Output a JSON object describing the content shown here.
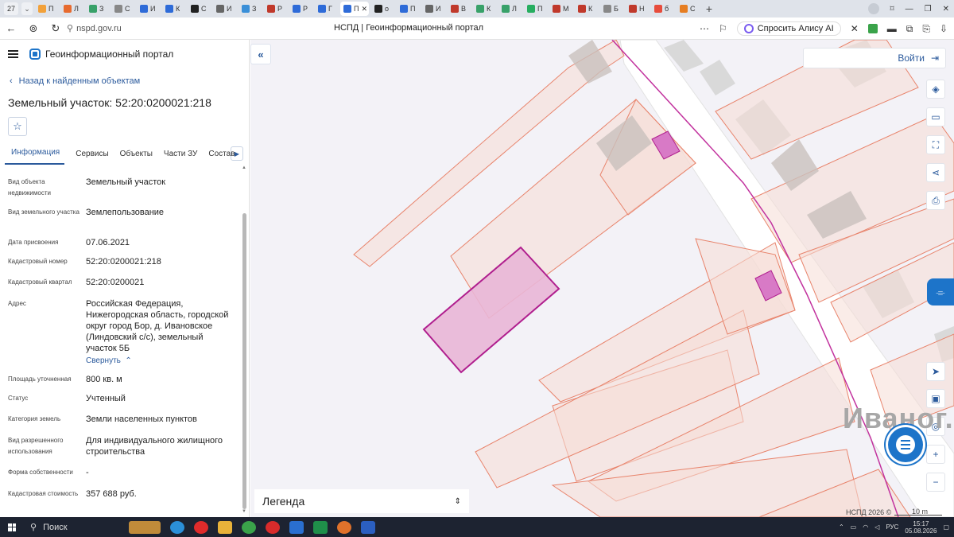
{
  "browser": {
    "tab_counter": "27",
    "tabs": [
      {
        "label": "П",
        "color": "#f2a13a"
      },
      {
        "label": "Л",
        "color": "#e76b2f"
      },
      {
        "label": "З",
        "color": "#38a169"
      },
      {
        "label": "С",
        "color": "#888888"
      },
      {
        "label": "И",
        "color": "#2e6bd8"
      },
      {
        "label": "К",
        "color": "#2e6bd8"
      },
      {
        "label": "С",
        "color": "#222222"
      },
      {
        "label": "И",
        "color": "#666666"
      },
      {
        "label": "З",
        "color": "#3a8fd8"
      },
      {
        "label": "Р",
        "color": "#c0392b"
      },
      {
        "label": "Р",
        "color": "#2e6bd8"
      },
      {
        "label": "Г",
        "color": "#2e6bd8"
      },
      {
        "label": "П",
        "color": "#2e6bd8"
      },
      {
        "label": "о",
        "color": "#222222"
      },
      {
        "label": "П",
        "color": "#2e6bd8"
      },
      {
        "label": "И",
        "color": "#666666"
      },
      {
        "label": "В",
        "color": "#c0392b"
      },
      {
        "label": "К",
        "color": "#38a169"
      },
      {
        "label": "Л",
        "color": "#38a169"
      },
      {
        "label": "П",
        "color": "#27ae60"
      },
      {
        "label": "М",
        "color": "#c0392b"
      },
      {
        "label": "К",
        "color": "#c0392b"
      },
      {
        "label": "Б",
        "color": "#888888"
      },
      {
        "label": "Н",
        "color": "#c0392b"
      },
      {
        "label": "б",
        "color": "#e74c3c"
      },
      {
        "label": "С",
        "color": "#e67e22"
      }
    ],
    "url": "nspd.gov.ru",
    "page_title": "НСПД | Геоинформационный портал",
    "alice_label": "Спросить Алису AI"
  },
  "panel": {
    "app_title": "Геоинформационный портал",
    "back_label": "Назад к найденным объектам",
    "parcel_title": "Земельный участок: 52:20:0200021:218",
    "tabs": [
      "Информация",
      "Сервисы",
      "Объекты",
      "Части ЗУ",
      "Состав"
    ],
    "rows": [
      {
        "label": "Вид объекта недвижимости",
        "value": "Земельный участок"
      },
      {
        "label": "Вид земельного участка",
        "value": "Землепользование"
      },
      {
        "label": "Дата присвоения",
        "value": "07.06.2021"
      },
      {
        "label": "Кадастровый номер",
        "value": "52:20:0200021:218"
      },
      {
        "label": "Кадастровый квартал",
        "value": "52:20:0200021"
      },
      {
        "label": "Адрес",
        "value": "Российская Федерация, Нижегородская область, городской округ город Бор, д. Ивановское (Линдовский с/с), земельный участок 5Б"
      },
      {
        "label": "Площадь уточненная",
        "value": "800 кв. м"
      },
      {
        "label": "Статус",
        "value": "Учтенный"
      },
      {
        "label": "Категория земель",
        "value": "Земли населенных пунктов"
      },
      {
        "label": "Вид разрешенного использования",
        "value": "Для индивидуального жилищного строительства"
      },
      {
        "label": "Форма собственности",
        "value": "-"
      },
      {
        "label": "Кадастровая стоимость",
        "value": "357 688 руб."
      }
    ],
    "collapse_label": "Свернуть"
  },
  "map": {
    "login_label": "Войти",
    "village_label": "Иваног.",
    "legend_label": "Легенда",
    "attribution": "НСПД 2026 ©",
    "scale_label": "10 m",
    "colors": {
      "parcel_stroke": "#e8836b",
      "parcel_fill": "#f6dcd6",
      "selected_fill": "#e9b6d6",
      "selected_stroke": "#b01e8e",
      "building_fill": "#c9c1bd",
      "road_fill": "#ffffff",
      "boundary": "#c2329e"
    }
  },
  "taskbar": {
    "search_label": "Поиск",
    "lang": "РУС",
    "time": "15:17",
    "date": "05.08.2026"
  }
}
